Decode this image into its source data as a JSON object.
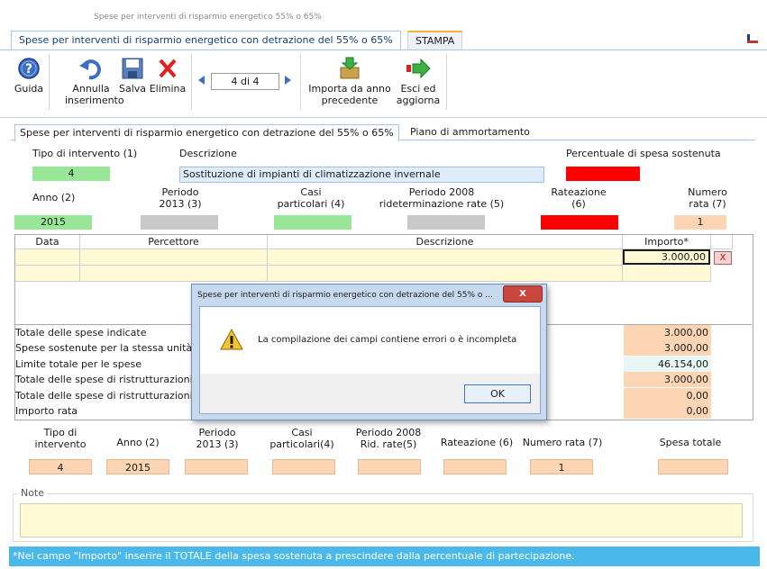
{
  "window": {
    "title": "Spese per interventi di risparmio energetico 55% o 65%",
    "tabs": [
      {
        "label": "Spese per interventi di risparmio energetico con detrazione del 55% o 65%"
      },
      {
        "label": "STAMPA"
      }
    ]
  },
  "toolbar": {
    "guida": "Guida",
    "annulla_line1": "Annulla",
    "annulla_line2": "inserimento",
    "salva": "Salva",
    "elimina": "Elimina",
    "nav_value": "4 di 4",
    "importa_line1": "Importa da anno",
    "importa_line2": "precedente",
    "esci_line1": "Esci ed",
    "esci_line2": "aggiorna"
  },
  "subtabs": [
    {
      "label": "Spese per interventi di risparmio energetico con detrazione del 55% o 65%"
    },
    {
      "label": "Piano di ammortamento"
    }
  ],
  "form": {
    "tipo_label": "Tipo di intervento (1)",
    "tipo_value": "4",
    "descrizione_label": "Descrizione",
    "descrizione_value": "Sostituzione di impianti di climatizzazione invernale",
    "percentuale_label": "Percentuale di spesa sostenuta",
    "anno_label": "Anno (2)",
    "anno_value": "2015",
    "periodo2013_line1": "Periodo",
    "periodo2013_line2": "2013 (3)",
    "casi_line1": "Casi",
    "casi_line2": "particolari (4)",
    "periodo2008_line1": "Periodo 2008",
    "periodo2008_line2": "rideterminazione rate (5)",
    "rateazione_line1": "Rateazione",
    "rateazione_line2": "(6)",
    "numero_rata_line1": "Numero",
    "numero_rata_line2": "rata (7)",
    "numero_rata_value": "1"
  },
  "table": {
    "headers": [
      "Data",
      "Percettore",
      "Descrizione",
      "Importo*"
    ],
    "rows": [
      {
        "data": "",
        "percettore": "",
        "descrizione": "",
        "importo": "3.000,00"
      }
    ],
    "delete_label": "X"
  },
  "totals": [
    {
      "label": "Totale delle spese indicate",
      "value": "3.000,00"
    },
    {
      "label": "Spese sostenute per la stessa unità",
      "value": "3.000,00"
    },
    {
      "label": "Limite totale per le spese",
      "value": "46.154,00"
    },
    {
      "label": "Totale delle spese di ristrutturazioni",
      "value": "3.000,00"
    },
    {
      "label": "Totale delle spese di ristrutturazioni",
      "value": "0,00"
    },
    {
      "label": "Importo rata",
      "value": "0,00"
    }
  ],
  "summary": {
    "tipo_line1": "Tipo di",
    "tipo_line2": "intervento",
    "anno": "Anno (2)",
    "periodo_line1": "Periodo",
    "periodo_line2": "2013 (3)",
    "casi_line1": "Casi",
    "casi_line2": "particolari(4)",
    "p2008_line1": "Periodo 2008",
    "p2008_line2": "Rid. rate(5)",
    "rateazione": "Rateazione (6)",
    "numero_rata": "Numero rata (7)",
    "spesa_totale": "Spesa totale",
    "tipo_value": "4",
    "anno_value": "2015",
    "numero_rata_value": "1"
  },
  "note_label": "Note",
  "footer_text": "*Nel campo \"Importo\" inserire il TOTALE della spesa sostenuta a prescindere dalla percentuale di partecipazione.",
  "dialog": {
    "title": "Spese per interventi di risparmio energetico con detrazione del 55% o ...",
    "message": "La compilazione dei campi contiene errori o è incompleta",
    "ok_label": "OK",
    "close_label": "X"
  },
  "colors": {
    "ok_field": "#99e699",
    "error_field": "#ff0000",
    "readonly_field": "#c9c9c9",
    "computed_field": "#fcd5b4",
    "footer_bg": "#4ab8e8"
  }
}
